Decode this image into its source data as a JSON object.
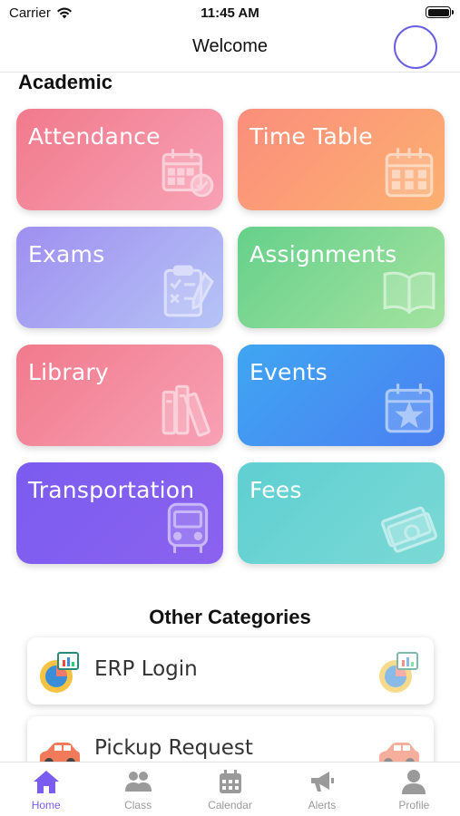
{
  "status": {
    "carrier": "Carrier",
    "time": "11:45 AM"
  },
  "header": {
    "title": "Welcome"
  },
  "academic": {
    "title": "Academic",
    "cards": [
      {
        "label": "Attendance",
        "icon": "calendar-check-icon"
      },
      {
        "label": "Time Table",
        "icon": "calendar-grid-icon"
      },
      {
        "label": "Exams",
        "icon": "checklist-icon"
      },
      {
        "label": "Assignments",
        "icon": "open-book-icon"
      },
      {
        "label": "Library",
        "icon": "books-icon"
      },
      {
        "label": "Events",
        "icon": "calendar-star-icon"
      },
      {
        "label": "Transportation",
        "icon": "bus-icon"
      },
      {
        "label": "Fees",
        "icon": "money-icon"
      }
    ]
  },
  "other": {
    "title": "Other Categories",
    "items": [
      {
        "label": "ERP Login",
        "icon": "erp-chart-icon"
      },
      {
        "label": "Pickup Request",
        "icon": "car-icon"
      }
    ]
  },
  "tabs": [
    {
      "label": "Home",
      "icon": "home-icon",
      "active": true
    },
    {
      "label": "Class",
      "icon": "class-group-icon",
      "active": false
    },
    {
      "label": "Calendar",
      "icon": "calendar-icon",
      "active": false
    },
    {
      "label": "Alerts",
      "icon": "megaphone-icon",
      "active": false
    },
    {
      "label": "Profile",
      "icon": "profile-icon",
      "active": false
    }
  ],
  "colors": {
    "accent": "#7b5cf0",
    "inactive_tab": "#9a9a9a"
  }
}
